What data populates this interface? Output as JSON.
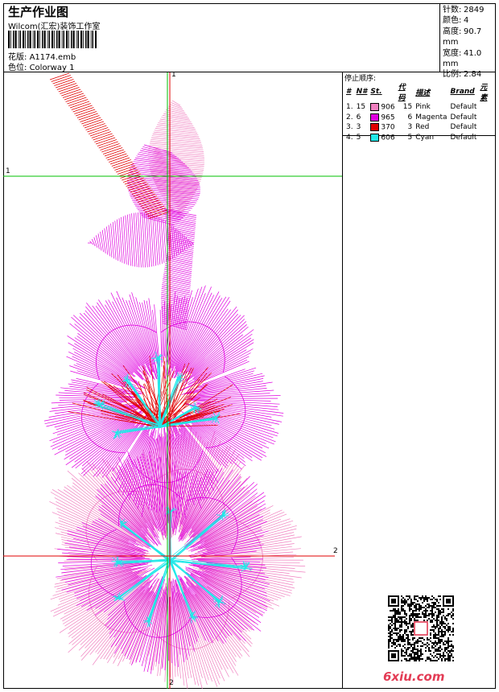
{
  "header": {
    "title": "生产作业图",
    "company": "Wilcom(汇宏)装饰工作室",
    "design_label": "花版:",
    "design_value": "A1174.emb",
    "colorway_label": "色位:",
    "colorway_value": "Colorway 1"
  },
  "stats": {
    "stitches_label": "针数:",
    "stitches_value": "2849",
    "colors_label": "颜色:",
    "colors_value": "4",
    "height_label": "高度:",
    "height_value": "90.7 mm",
    "width_label": "宽度:",
    "width_value": "41.0 mm",
    "scale_label": "比例:",
    "scale_value": "2.84"
  },
  "stop_sequence": {
    "title": "停止顺序:",
    "columns": [
      "#",
      "N#",
      "St.",
      "代码",
      "描述",
      "Brand",
      "元素"
    ],
    "rows": [
      {
        "idx": "1.",
        "n": "15",
        "color": "#f080c0",
        "code": "906",
        "st": "15",
        "desc": "Pink",
        "brand": "Default"
      },
      {
        "idx": "2.",
        "n": "6",
        "color": "#e000e0",
        "code": "965",
        "st": "6",
        "desc": "Magenta",
        "brand": "Default"
      },
      {
        "idx": "3.",
        "n": "3",
        "color": "#e00000",
        "code": "370",
        "st": "3",
        "desc": "Red",
        "brand": "Default"
      },
      {
        "idx": "4.",
        "n": "5",
        "color": "#20e8e8",
        "code": "606",
        "st": "5",
        "desc": "Cyan",
        "brand": "Default"
      }
    ]
  },
  "axes": {
    "v_top": "1",
    "h_left": "1",
    "h_right": "2",
    "v_bottom": "2"
  },
  "watermark": "6xiu.com",
  "colors": {
    "guide_green": "#00c000",
    "guide_red": "#e00000",
    "guide_orange": "#c08000"
  }
}
